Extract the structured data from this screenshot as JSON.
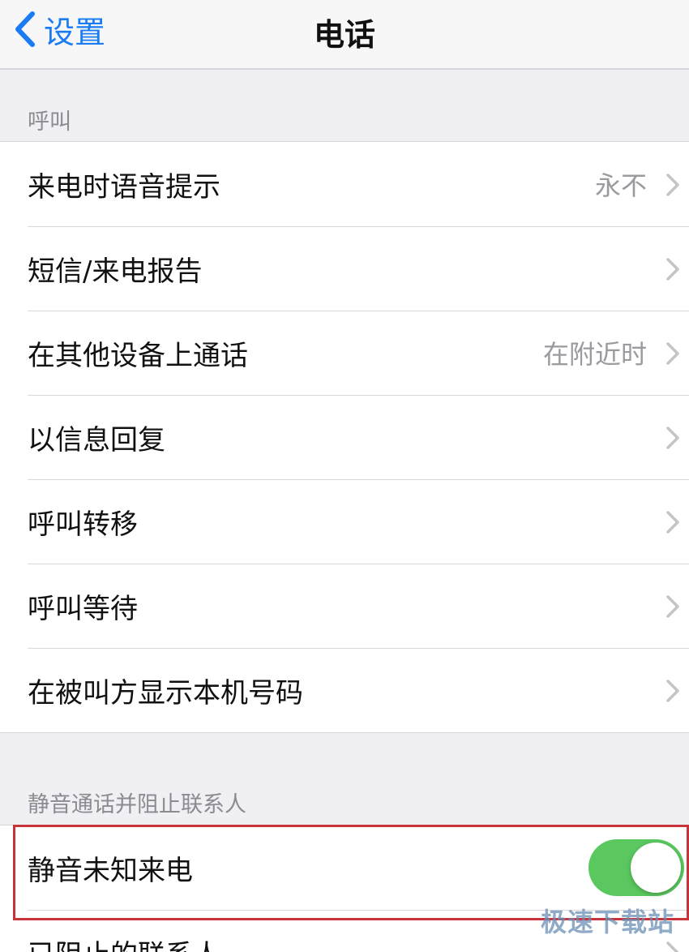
{
  "nav": {
    "back_label": "设置",
    "title": "电话"
  },
  "sections": {
    "calls": {
      "header": "呼叫",
      "rows": [
        {
          "label": "来电时语音提示",
          "value": "永不"
        },
        {
          "label": "短信/来电报告",
          "value": ""
        },
        {
          "label": "在其他设备上通话",
          "value": "在附近时"
        },
        {
          "label": "以信息回复",
          "value": ""
        },
        {
          "label": "呼叫转移",
          "value": ""
        },
        {
          "label": "呼叫等待",
          "value": ""
        },
        {
          "label": "在被叫方显示本机号码",
          "value": ""
        }
      ]
    },
    "silence": {
      "header": "静音通话并阻止联系人",
      "toggle_row": {
        "label": "静音未知来电",
        "on": true
      },
      "blocked_row": {
        "label": "已阻止的联系人"
      }
    }
  },
  "watermark": "极速下载站",
  "colors": {
    "accent": "#1a7cf5",
    "toggle_on": "#5ac85e",
    "highlight": "#c8343b"
  }
}
